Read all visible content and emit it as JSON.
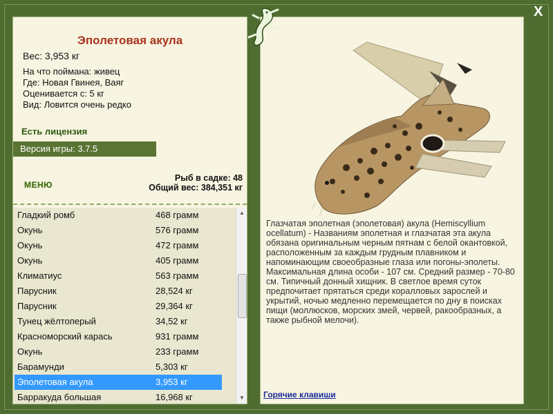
{
  "fish": {
    "title": "Эполетовая акула",
    "weight": "Вес: 3,953 кг",
    "caught_with": "На что поймана: живец",
    "location": "Где: Новая Гвинея, Ваяг",
    "rated_from": "Оценивается с: 5 кг",
    "kind": "Вид: Ловится очень редко"
  },
  "license": "Есть лицензия",
  "version": "Версия игры: 3.7.5",
  "menu_label": "МЕНЮ",
  "stats": {
    "fish_count": "Рыб в садке: 48",
    "total_weight": "Общий вес: 384,351 кг"
  },
  "fish_list": [
    {
      "name": "Гладкий ромб",
      "weight": "468 грамм"
    },
    {
      "name": "Окунь",
      "weight": "576 грамм"
    },
    {
      "name": "Окунь",
      "weight": "472 грамм"
    },
    {
      "name": "Окунь",
      "weight": "405 грамм"
    },
    {
      "name": "Климатиус",
      "weight": "563 грамм"
    },
    {
      "name": "Парусник",
      "weight": "28,524 кг"
    },
    {
      "name": "Парусник",
      "weight": "29,364 кг"
    },
    {
      "name": "Тунец жёлтоперый",
      "weight": "34,52 кг"
    },
    {
      "name": "Красноморский карась",
      "weight": "931 грамм"
    },
    {
      "name": "Окунь",
      "weight": "233 грамм"
    },
    {
      "name": "Барамунди",
      "weight": "5,303 кг"
    },
    {
      "name": "Эполетовая акула",
      "weight": "3,953 кг"
    },
    {
      "name": "Барракуда большая",
      "weight": "16,968 кг"
    }
  ],
  "description": "Глазчатая эполетная (эполетовая) акула (Hemiscyllium ocellatum) - Названиям эполетная и глазчатая эта акула обязана оригинальным черным пятнам с белой окантовкой, расположенным за каждым грудным плавником и напоминающим своеобразные глаза или погоны-эполеты. Максимальная длина особи - 107 см. Средний размер - 70-80 см. Типичный донный хищник. В светлое время суток предпочитает прятаться среди коралловых зарослей и укрытий, ночью медленно перемещается по дну в поисках пищи (моллюсков, морских змей, червей, ракообразных, а также рыбной мелочи).",
  "hotkeys": "Горячие клавиши",
  "close_label": "X",
  "colors": {
    "frame": "#4f6d31",
    "panel": "#f7f4e1",
    "title": "#a8331e",
    "selection": "#3399ff",
    "version_bar": "#5a7434"
  },
  "icons": {
    "logo": "gecko-logo-icon",
    "close": "close-icon",
    "scroll_up": "scroll-up-arrow-icon",
    "scroll_down": "scroll-down-arrow-icon"
  }
}
